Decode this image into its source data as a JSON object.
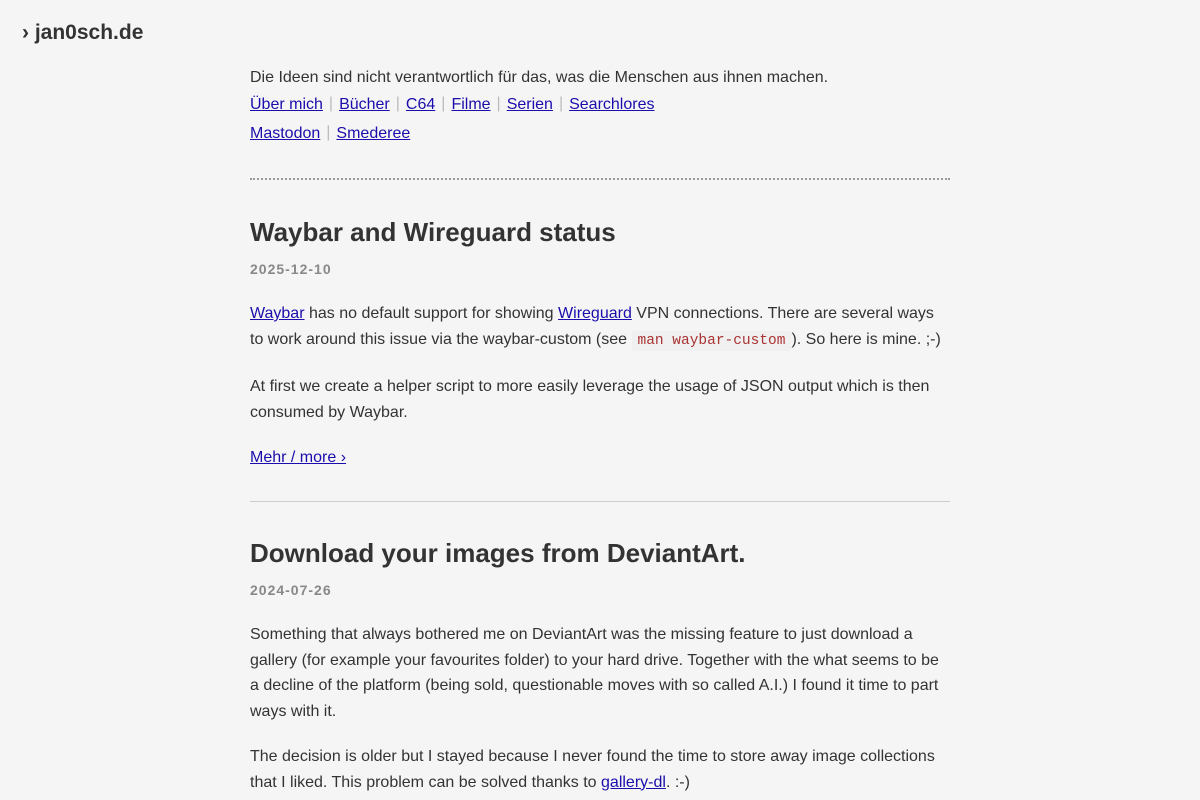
{
  "site": {
    "title": "› jan0sch.de"
  },
  "tagline": "Die Ideen sind nicht verantwortlich für das, was die Menschen aus ihnen machen.",
  "nav": {
    "row1": [
      "Über mich",
      "Bücher",
      "C64",
      "Filme",
      "Serien",
      "Searchlores"
    ],
    "row2": [
      "Mastodon",
      "Smederee"
    ]
  },
  "posts": [
    {
      "title": "Waybar and Wireguard status",
      "date": "2025-12-10",
      "p1": {
        "link1": "Waybar",
        "text1": " has no default support for showing ",
        "link2": "Wireguard",
        "text2": " VPN connections. There are several ways to work around this issue via the waybar-custom (see ",
        "code": "man waybar-custom",
        "text3": "). So here is mine. ;-)"
      },
      "p2": "At first we create a helper script to more easily leverage the usage of JSON output which is then consumed by Waybar.",
      "more": "Mehr / more ›"
    },
    {
      "title": "Download your images from DeviantArt.",
      "date": "2024-07-26",
      "p1": "Something that always bothered me on DeviantArt was the missing feature to just download a gallery (for example your favourites folder) to your hard drive. Together with the what seems to be a decline of the platform (being sold, questionable moves with so called A.I.) I found it time to part ways with it.",
      "p2": {
        "text1": "The decision is older but I stayed because I never found the time to store away image collections that I liked. This problem can be solved thanks to ",
        "link": "gallery-dl",
        "text2": ". :-)"
      }
    }
  ],
  "colors": {
    "link": "#1a0dab",
    "text": "#333333",
    "date": "#888888",
    "code": "#aa3333"
  }
}
